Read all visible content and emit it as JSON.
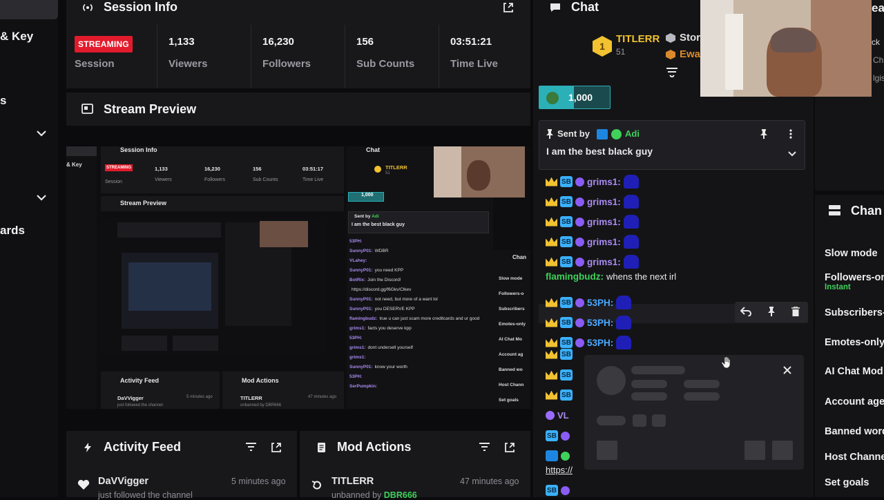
{
  "sidebar": {
    "items": [
      {
        "label": "& Key"
      },
      {
        "label": "s"
      },
      {
        "label": "ards"
      }
    ]
  },
  "session": {
    "title": "Session Info",
    "badge": "STREAMING",
    "badge_caption": "Session",
    "stats": [
      {
        "value": "1,133",
        "label": "Viewers"
      },
      {
        "value": "16,230",
        "label": "Followers"
      },
      {
        "value": "156",
        "label": "Sub Counts"
      },
      {
        "value": "03:51:21",
        "label": "Time Live"
      }
    ]
  },
  "preview": {
    "title": "Stream Preview",
    "mini": {
      "session_title": "Session Info",
      "chat_title": "Chat",
      "key_label": "& Key",
      "badge": "STREAMING",
      "badge_caption": "Session",
      "stats": [
        {
          "value": "1,133",
          "label": "Viewers"
        },
        {
          "value": "16,230",
          "label": "Followers"
        },
        {
          "value": "156",
          "label": "Sub Counts"
        },
        {
          "value": "03:51:17",
          "label": "Time Live"
        }
      ],
      "preview_title": "Stream Preview",
      "activity_title": "Activity Feed",
      "mod_title": "Mod Actions",
      "activity_user": "DaVVigger",
      "activity_time": "5 minutes ago",
      "activity_text": "just followed the channel",
      "mod_user": "TITLERR",
      "mod_time": "47 minutes ago",
      "mod_text": "unbanned by DBR666",
      "channel_label": "Chan",
      "settings": [
        "Slow mode",
        "Followers-o",
        "Subscribers",
        "Emotes-only",
        "AI Chat Mo",
        "Account ag",
        "Banned wo",
        "Host Chann",
        "Set goals"
      ],
      "settings_sub": "Instant",
      "pinned_sent_by": "Sent by",
      "pinned_user": "Adi",
      "pinned_text": "I am the best black guy",
      "goal": "1,000",
      "top_user": "TITLERR",
      "top_user_count": "51",
      "chat_lines": [
        {
          "user": "53PH:",
          "text": ""
        },
        {
          "user": "SunnyP01:",
          "text": "WDBR"
        },
        {
          "user": "VLahey:",
          "text": ""
        },
        {
          "user": "SunnyP01:",
          "text": "you need KPP"
        },
        {
          "user": "BotRix:",
          "text": "Join the Discord!"
        },
        {
          "user": "",
          "text": "https://discord.gg/f6Gkv/Clkev"
        },
        {
          "user": "SunnyP01:",
          "text": "not need, but more of a want lol"
        },
        {
          "user": "SunnyP01:",
          "text": "you DESERVE KPP"
        },
        {
          "user": "flamingbudz:",
          "text": "true u can just scam more creditcards and ur good"
        },
        {
          "user": "grims1:",
          "text": "facts you deserve kpp"
        },
        {
          "user": "53PH:",
          "text": ""
        },
        {
          "user": "grims1:",
          "text": "dont undersell yourself"
        },
        {
          "user": "grims1:",
          "text": ""
        },
        {
          "user": "SunnyP01:",
          "text": "know your worth"
        },
        {
          "user": "53PH:",
          "text": ""
        },
        {
          "user": "SerPumpkin:",
          "text": ""
        }
      ]
    }
  },
  "activity": {
    "title": "Activity Feed",
    "item_user": "DaVVigger",
    "item_time": "5 minutes ago",
    "item_text": "just followed the channel"
  },
  "mod": {
    "title": "Mod Actions",
    "item_user": "TITLERR",
    "item_time": "47 minutes ago",
    "item_text_prefix": "unbanned by",
    "item_actor": "DBR666"
  },
  "chat": {
    "title": "Chat",
    "top_users": [
      {
        "name": "TITLERR",
        "count": "51"
      },
      {
        "name": "Stor"
      },
      {
        "name": "Ewa"
      }
    ],
    "top_rank": "1",
    "goal_value": "1,000",
    "pinned": {
      "sent_by": "Sent by",
      "user": "Adi",
      "text": "I am the best black guy"
    },
    "lines": [
      {
        "user": "grims1:",
        "text": ""
      },
      {
        "user": "grims1:",
        "text": ""
      },
      {
        "user": "grims1:",
        "text": ""
      },
      {
        "user": "grims1:",
        "text": ""
      },
      {
        "user": "grims1:",
        "text": ""
      },
      {
        "user": "flamingbudz:",
        "text": "whens the next irl"
      },
      {
        "user": "53PH:",
        "text": ""
      },
      {
        "user": "53PH:",
        "text": ""
      },
      {
        "user": "53PH:",
        "text": ""
      }
    ],
    "partial_user": "VL",
    "partial_link": "https://"
  },
  "channel": {
    "title": "Chan",
    "settings": [
      {
        "label": "Slow mode"
      },
      {
        "label": "Followers-on",
        "sub": "Instant"
      },
      {
        "label": "Subscribers-"
      },
      {
        "label": "Emotes-only"
      },
      {
        "label": "AI Chat Mod"
      },
      {
        "label": "Account age"
      },
      {
        "label": "Banned word"
      },
      {
        "label": "Host Channe"
      },
      {
        "label": "Set goals"
      }
    ]
  },
  "webcam": {
    "partial_texts": [
      "ea",
      "ck",
      "Ch",
      "lgis"
    ]
  },
  "colors": {
    "accent_red": "#e21b2c",
    "gold": "#f2c230",
    "teal": "#2bb0b8",
    "green": "#3fd15a",
    "purple": "#a98bf2",
    "link_blue": "#7ab8ff"
  }
}
